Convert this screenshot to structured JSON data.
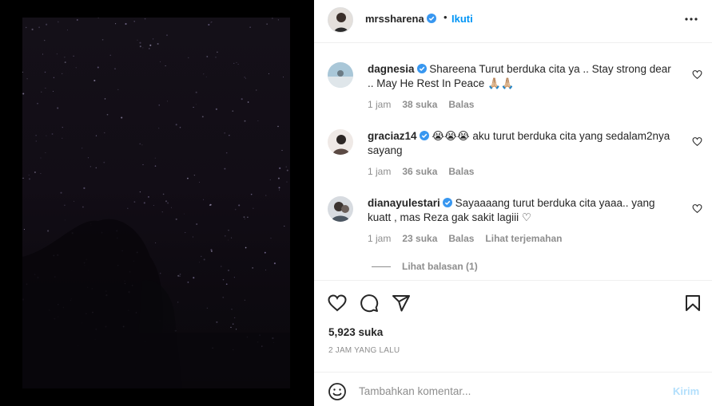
{
  "post": {
    "author": "mrssharena",
    "dot": "•",
    "follow_label": "Ikuti",
    "more_icon": "more-horizontal-icon",
    "media_description_icon": "night-sky-photo"
  },
  "comments": [
    {
      "username": "dagnesia",
      "verified": true,
      "text": "Shareena Turut berduka cita ya .. Stay strong dear .. May He Rest In Peace 🙏🏼🙏🏼",
      "time": "1 jam",
      "likes": "38 suka",
      "reply": "Balas",
      "translate": ""
    },
    {
      "username": "graciaz14",
      "verified": true,
      "text": "😭😭😭 aku turut berduka cita yang sedalam2nya sayang",
      "time": "1 jam",
      "likes": "36 suka",
      "reply": "Balas",
      "translate": ""
    },
    {
      "username": "dianayulestari",
      "verified": true,
      "text": "Sayaaaang turut berduka cita yaaa.. yang kuatt , mas Reza gak sakit lagiii ♡",
      "time": "1 jam",
      "likes": "23 suka",
      "reply": "Balas",
      "translate": "Lihat terjemahan"
    }
  ],
  "view_replies": "Lihat balasan (1)",
  "actions": {
    "like_icon": "heart-icon",
    "comment_icon": "comment-icon",
    "share_icon": "send-icon",
    "save_icon": "bookmark-icon"
  },
  "likes_count": "5,923 suka",
  "posted_time": "2 JAM YANG LALU",
  "composer": {
    "emoji_icon": "smiley-icon",
    "placeholder": "Tambahkan komentar...",
    "send_label": "Kirim"
  },
  "colors": {
    "link": "#0095f6",
    "send_disabled": "#b2dffc",
    "muted": "#8e8e8e",
    "verified": "#3897f0"
  }
}
